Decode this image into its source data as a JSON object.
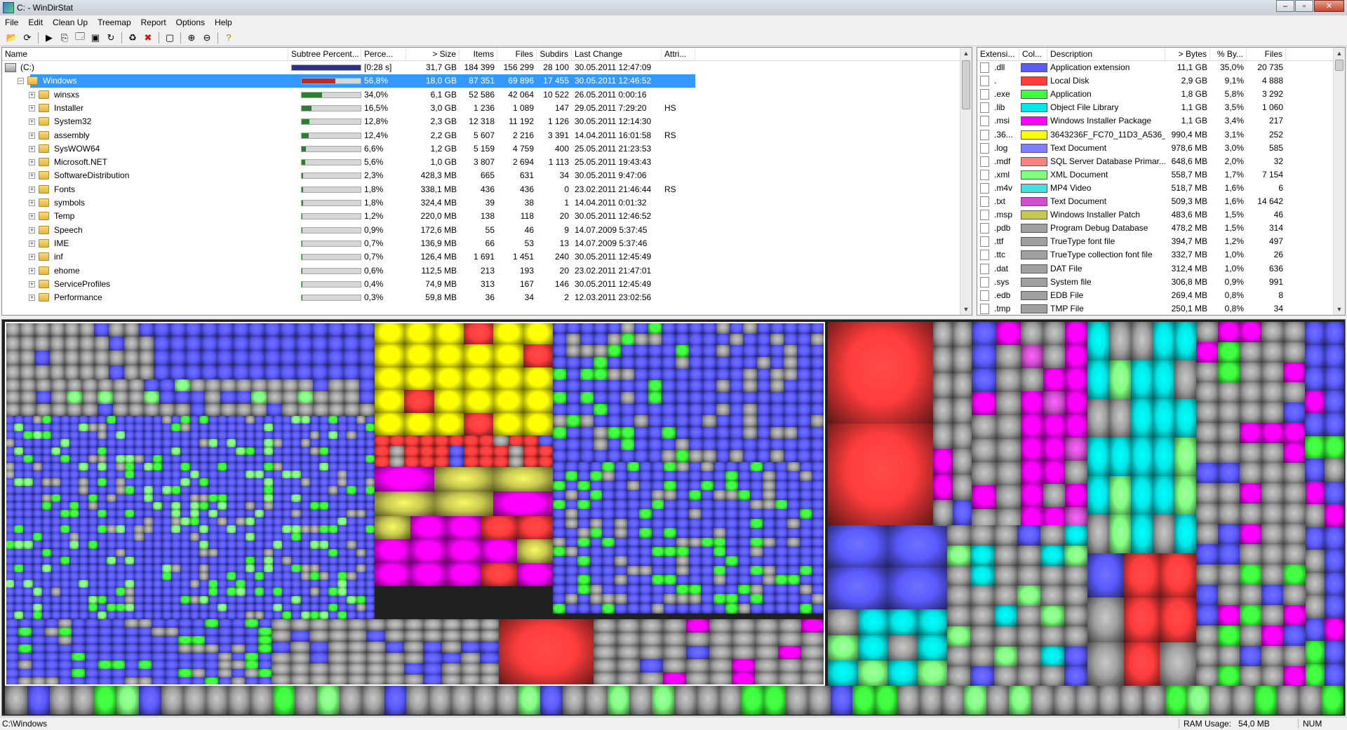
{
  "window": {
    "title": "C: - WinDirStat",
    "min_label": "–",
    "max_label": "▫",
    "close_label": "✕"
  },
  "menu": [
    "File",
    "Edit",
    "Clean Up",
    "Treemap",
    "Report",
    "Options",
    "Help"
  ],
  "toolbar": [
    {
      "name": "open-icon",
      "glyph": "📂"
    },
    {
      "name": "refresh-icon",
      "glyph": "⟳"
    },
    {
      "sep": true
    },
    {
      "name": "run-icon",
      "glyph": "▶"
    },
    {
      "name": "copy-icon",
      "glyph": "⎘"
    },
    {
      "name": "explorer-icon",
      "glyph": "🗔"
    },
    {
      "name": "cmd-icon",
      "glyph": "▣"
    },
    {
      "name": "refresh-selected-icon",
      "glyph": "↻"
    },
    {
      "sep": true
    },
    {
      "name": "recycle-icon",
      "glyph": "♻"
    },
    {
      "name": "delete-icon",
      "glyph": "✖",
      "color": "#d01010"
    },
    {
      "sep": true
    },
    {
      "name": "properties-icon",
      "glyph": "▢"
    },
    {
      "sep": true
    },
    {
      "name": "zoom-in-icon",
      "glyph": "⊕"
    },
    {
      "name": "zoom-out-icon",
      "glyph": "⊖"
    },
    {
      "sep": true
    },
    {
      "name": "help-icon",
      "glyph": "?",
      "color": "#b08000"
    }
  ],
  "tree": {
    "columns": [
      "Name",
      "Subtree Percent...",
      "Perce...",
      "> Size",
      "Items",
      "Files",
      "Subdirs",
      "Last Change",
      "Attri..."
    ],
    "rows": [
      {
        "name": "(C:)",
        "level": 0,
        "icon": "drive",
        "expander": "",
        "bar": 1.0,
        "bar_color": "#2b2f8f",
        "perc": "[0:28 s]",
        "size": "31,7 GB",
        "items": "184 399",
        "files": "156 299",
        "subdirs": "28 100",
        "change": "30.05.2011  12:47:09",
        "attr": ""
      },
      {
        "name": "Windows",
        "level": 1,
        "icon": "folder",
        "expander": "−",
        "selected": true,
        "bar": 0.568,
        "bar_color": "#b03030",
        "perc": "56,8%",
        "size": "18,0 GB",
        "items": "87 351",
        "files": "69 896",
        "subdirs": "17 455",
        "change": "30.05.2011  12:46:52",
        "attr": ""
      },
      {
        "name": "winsxs",
        "level": 2,
        "icon": "folder",
        "expander": "+",
        "bar": 0.34,
        "bar_color": "#2e7d32",
        "perc": "34,0%",
        "size": "6,1 GB",
        "items": "52 586",
        "files": "42 064",
        "subdirs": "10 522",
        "change": "26.05.2011  0:00:16",
        "attr": ""
      },
      {
        "name": "Installer",
        "level": 2,
        "icon": "folder",
        "expander": "+",
        "bar": 0.165,
        "bar_color": "#2e7d32",
        "perc": "16,5%",
        "size": "3,0 GB",
        "items": "1 236",
        "files": "1 089",
        "subdirs": "147",
        "change": "29.05.2011  7:29:20",
        "attr": "HS"
      },
      {
        "name": "System32",
        "level": 2,
        "icon": "folder",
        "expander": "+",
        "bar": 0.128,
        "bar_color": "#2e7d32",
        "perc": "12,8%",
        "size": "2,3 GB",
        "items": "12 318",
        "files": "11 192",
        "subdirs": "1 126",
        "change": "30.05.2011  12:14:30",
        "attr": ""
      },
      {
        "name": "assembly",
        "level": 2,
        "icon": "folder",
        "expander": "+",
        "bar": 0.124,
        "bar_color": "#2e7d32",
        "perc": "12,4%",
        "size": "2,2 GB",
        "items": "5 607",
        "files": "2 216",
        "subdirs": "3 391",
        "change": "14.04.2011  16:01:58",
        "attr": "RS"
      },
      {
        "name": "SysWOW64",
        "level": 2,
        "icon": "folder",
        "expander": "+",
        "bar": 0.066,
        "bar_color": "#2e7d32",
        "perc": "6,6%",
        "size": "1,2 GB",
        "items": "5 159",
        "files": "4 759",
        "subdirs": "400",
        "change": "25.05.2011  21:23:53",
        "attr": ""
      },
      {
        "name": "Microsoft.NET",
        "level": 2,
        "icon": "folder",
        "expander": "+",
        "bar": 0.056,
        "bar_color": "#2e7d32",
        "perc": "5,6%",
        "size": "1,0 GB",
        "items": "3 807",
        "files": "2 694",
        "subdirs": "1 113",
        "change": "25.05.2011  19:43:43",
        "attr": ""
      },
      {
        "name": "SoftwareDistribution",
        "level": 2,
        "icon": "folder",
        "expander": "+",
        "bar": 0.023,
        "bar_color": "#2e7d32",
        "perc": "2,3%",
        "size": "428,3 MB",
        "items": "665",
        "files": "631",
        "subdirs": "34",
        "change": "30.05.2011  9:47:06",
        "attr": ""
      },
      {
        "name": "Fonts",
        "level": 2,
        "icon": "folder",
        "expander": "+",
        "bar": 0.018,
        "bar_color": "#2e7d32",
        "perc": "1,8%",
        "size": "338,1 MB",
        "items": "436",
        "files": "436",
        "subdirs": "0",
        "change": "23.02.2011  21:46:44",
        "attr": "RS"
      },
      {
        "name": "symbols",
        "level": 2,
        "icon": "folder",
        "expander": "+",
        "bar": 0.018,
        "bar_color": "#2e7d32",
        "perc": "1,8%",
        "size": "324,4 MB",
        "items": "39",
        "files": "38",
        "subdirs": "1",
        "change": "14.04.2011  0:01:32",
        "attr": ""
      },
      {
        "name": "Temp",
        "level": 2,
        "icon": "folder",
        "expander": "+",
        "bar": 0.012,
        "bar_color": "#2e7d32",
        "perc": "1,2%",
        "size": "220,0 MB",
        "items": "138",
        "files": "118",
        "subdirs": "20",
        "change": "30.05.2011  12:46:52",
        "attr": ""
      },
      {
        "name": "Speech",
        "level": 2,
        "icon": "folder",
        "expander": "+",
        "bar": 0.009,
        "bar_color": "#2e7d32",
        "perc": "0,9%",
        "size": "172,6 MB",
        "items": "55",
        "files": "46",
        "subdirs": "9",
        "change": "14.07.2009  5:37:45",
        "attr": ""
      },
      {
        "name": "IME",
        "level": 2,
        "icon": "folder",
        "expander": "+",
        "bar": 0.007,
        "bar_color": "#2e7d32",
        "perc": "0,7%",
        "size": "136,9 MB",
        "items": "66",
        "files": "53",
        "subdirs": "13",
        "change": "14.07.2009  5:37:46",
        "attr": ""
      },
      {
        "name": "inf",
        "level": 2,
        "icon": "folder",
        "expander": "+",
        "bar": 0.007,
        "bar_color": "#2e7d32",
        "perc": "0,7%",
        "size": "126,4 MB",
        "items": "1 691",
        "files": "1 451",
        "subdirs": "240",
        "change": "30.05.2011  12:45:49",
        "attr": ""
      },
      {
        "name": "ehome",
        "level": 2,
        "icon": "folder",
        "expander": "+",
        "bar": 0.006,
        "bar_color": "#2e7d32",
        "perc": "0,6%",
        "size": "112,5 MB",
        "items": "213",
        "files": "193",
        "subdirs": "20",
        "change": "23.02.2011  21:47:01",
        "attr": ""
      },
      {
        "name": "ServiceProfiles",
        "level": 2,
        "icon": "folder",
        "expander": "+",
        "bar": 0.004,
        "bar_color": "#2e7d32",
        "perc": "0,4%",
        "size": "74,9 MB",
        "items": "313",
        "files": "167",
        "subdirs": "146",
        "change": "30.05.2011  12:45:49",
        "attr": ""
      },
      {
        "name": "Performance",
        "level": 2,
        "icon": "folder",
        "expander": "+",
        "bar": 0.003,
        "bar_color": "#2e7d32",
        "perc": "0,3%",
        "size": "59,8 MB",
        "items": "36",
        "files": "34",
        "subdirs": "2",
        "change": "12.03.2011  23:02:56",
        "attr": ""
      }
    ]
  },
  "extensions": {
    "columns": [
      "Extensi...",
      "Col...",
      "Description",
      "> Bytes",
      "% By...",
      "Files"
    ],
    "rows": [
      {
        "ext": ".dll",
        "color": "#5a5aff",
        "desc": "Application extension",
        "bytes": "11,1 GB",
        "pct": "35,0%",
        "files": "20 735"
      },
      {
        "ext": ".",
        "color": "#ff3c3c",
        "desc": "Local Disk",
        "bytes": "2,9 GB",
        "pct": "9,1%",
        "files": "4 888"
      },
      {
        "ext": ".exe",
        "color": "#3cff3c",
        "desc": "Application",
        "bytes": "1,8 GB",
        "pct": "5,8%",
        "files": "3 292"
      },
      {
        "ext": ".lib",
        "color": "#00e8e8",
        "desc": "Object File Library",
        "bytes": "1,1 GB",
        "pct": "3,5%",
        "files": "1 060"
      },
      {
        "ext": ".msi",
        "color": "#ff00ff",
        "desc": "Windows Installer Package",
        "bytes": "1,1 GB",
        "pct": "3,4%",
        "files": "217"
      },
      {
        "ext": ".36...",
        "color": "#ffff00",
        "desc": "3643236F_FC70_11D3_A536_...",
        "bytes": "990,4 MB",
        "pct": "3,1%",
        "files": "252"
      },
      {
        "ext": ".log",
        "color": "#8080ff",
        "desc": "Text Document",
        "bytes": "978,6 MB",
        "pct": "3,0%",
        "files": "585"
      },
      {
        "ext": ".mdf",
        "color": "#ff8080",
        "desc": "SQL Server Database Primar...",
        "bytes": "648,6 MB",
        "pct": "2,0%",
        "files": "32"
      },
      {
        "ext": ".xml",
        "color": "#80ff80",
        "desc": "XML Document",
        "bytes": "558,7 MB",
        "pct": "1,7%",
        "files": "7 154"
      },
      {
        "ext": ".m4v",
        "color": "#40e0e0",
        "desc": "MP4 Video",
        "bytes": "518,7 MB",
        "pct": "1,6%",
        "files": "6"
      },
      {
        "ext": ".txt",
        "color": "#d050d0",
        "desc": "Text Document",
        "bytes": "509,3 MB",
        "pct": "1,6%",
        "files": "14 642"
      },
      {
        "ext": ".msp",
        "color": "#c8c850",
        "desc": "Windows Installer Patch",
        "bytes": "483,6 MB",
        "pct": "1,5%",
        "files": "46"
      },
      {
        "ext": ".pdb",
        "color": "#a0a0a0",
        "desc": "Program Debug Database",
        "bytes": "478,2 MB",
        "pct": "1,5%",
        "files": "314"
      },
      {
        "ext": ".ttf",
        "color": "#a0a0a0",
        "desc": "TrueType font file",
        "bytes": "394,7 MB",
        "pct": "1,2%",
        "files": "497"
      },
      {
        "ext": ".ttc",
        "color": "#a0a0a0",
        "desc": "TrueType collection font file",
        "bytes": "332,7 MB",
        "pct": "1,0%",
        "files": "26"
      },
      {
        "ext": ".dat",
        "color": "#a0a0a0",
        "desc": "DAT File",
        "bytes": "312,4 MB",
        "pct": "1,0%",
        "files": "636"
      },
      {
        "ext": ".sys",
        "color": "#a0a0a0",
        "desc": "System file",
        "bytes": "306,8 MB",
        "pct": "0,9%",
        "files": "991"
      },
      {
        "ext": ".edb",
        "color": "#a0a0a0",
        "desc": "EDB File",
        "bytes": "269,4 MB",
        "pct": "0,8%",
        "files": "8"
      },
      {
        "ext": ".tmp",
        "color": "#a0a0a0",
        "desc": "TMP File",
        "bytes": "250,1 MB",
        "pct": "0,8%",
        "files": "34"
      }
    ]
  },
  "treemap": {
    "palette": {
      "dll": "#5a5aff",
      "local": "#ff3c3c",
      "exe": "#3cff3c",
      "lib": "#00e8e8",
      "msi": "#ff00ff",
      "yellow": "#ffff00",
      "log": "#8080ff",
      "mdf": "#ff8080",
      "xml": "#80ff80",
      "m4v": "#40e0e0",
      "txt": "#d050d0",
      "msp": "#c8c850",
      "gray": "#a0a0a0"
    }
  },
  "status": {
    "path": "C:\\Windows",
    "ram_label": "RAM Usage:",
    "ram_value": "54,0 MB",
    "num": "NUM"
  }
}
